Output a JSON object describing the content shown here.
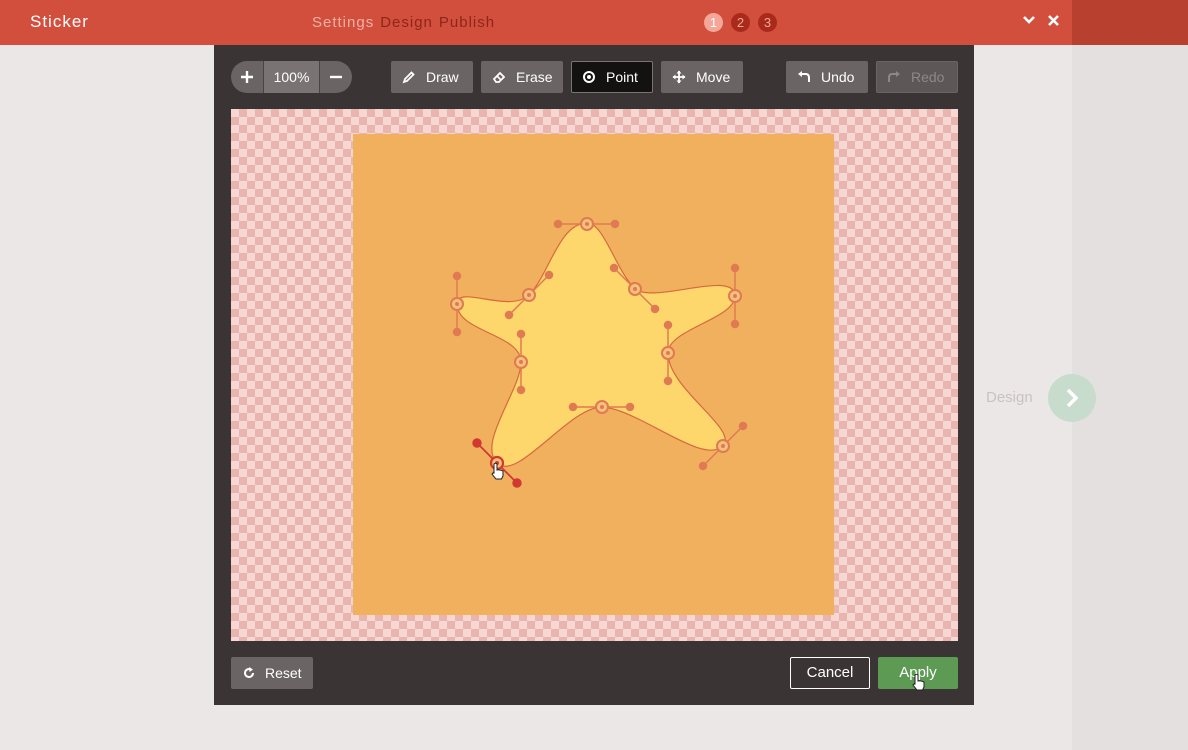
{
  "app": {
    "title": "Sticker"
  },
  "nav": {
    "steps": [
      {
        "label": "Settings",
        "state": "inactive"
      },
      {
        "label": "Design",
        "state": "active"
      },
      {
        "label": "Publish",
        "state": "active"
      }
    ],
    "step_numbers": [
      "1",
      "2",
      "3"
    ]
  },
  "window_controls": {
    "collapse_icon": "chevron-down-icon",
    "close_icon": "close-icon"
  },
  "zoom": {
    "plus_icon": "plus-icon",
    "value": "100%",
    "minus_icon": "minus-icon"
  },
  "tools": [
    {
      "label": "Draw",
      "icon": "pencil-icon"
    },
    {
      "label": "Erase",
      "icon": "eraser-icon"
    },
    {
      "label": "Point",
      "icon": "target-icon",
      "selected": true
    },
    {
      "label": "Move",
      "icon": "move-arrows-icon"
    }
  ],
  "history": {
    "undo": {
      "label": "Undo",
      "icon": "undo-icon"
    },
    "redo": {
      "label": "Redo",
      "icon": "redo-icon",
      "disabled": true
    }
  },
  "footer": {
    "reset": {
      "label": "Reset",
      "icon": "refresh-icon"
    },
    "cancel": {
      "label": "Cancel"
    },
    "apply": {
      "label": "Apply"
    }
  },
  "side": {
    "next_label": "Design",
    "next_icon": "chevron-right-icon"
  },
  "colors": {
    "topbar": "#d24f3d",
    "accent_active": "#8e2618",
    "sticker_bg": "#f0b05e",
    "star_fill": "#fdd66c",
    "control_points": "#e07a53",
    "apply_green": "#5d9a54"
  }
}
